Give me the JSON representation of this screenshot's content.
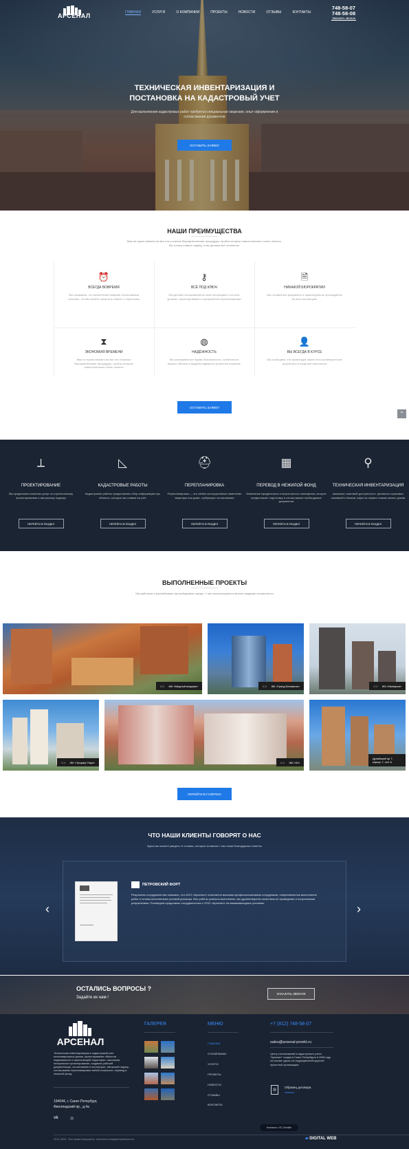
{
  "header": {
    "logo": "АРСЕНАЛ",
    "nav": [
      "ГЛАВНАЯ",
      "УСЛУГИ",
      "О КОМПАНИИ",
      "ПРОЕКТЫ",
      "НОВОСТИ",
      "ОТЗЫВЫ",
      "КОНТАКТЫ"
    ],
    "phone1": "748-58-07",
    "phone2": "748-58-08",
    "callback": "Заказать звонок"
  },
  "hero": {
    "title_line1": "ТЕХНИЧЕСКАЯ ИНВЕНТАРИЗАЦИЯ И",
    "title_line2": "ПОСТАНОВКА НА КАДАСТРОВЫЙ УЧЕТ",
    "subtitle": "Для выполнения кадастровых работ требуется специальная лицензия, опыт оформления и согласования документов",
    "button": "ОСТАВИТЬ ЗАЯВКУ"
  },
  "advantages": {
    "title": "НАШИ ПРЕИМУЩЕСТВА",
    "subtitle": "Вам не нужно вникать во все эти сложные бюрократические процедуры, пройти которые самостоятельно очень нелегко. Вы только ставите задачу, а мы делаем всё остальное.",
    "items": [
      {
        "title": "ВСЕГДА ВОВРЕМЯ",
        "text": "Мы понимаем, что выполнение вовремя согласования означает, что Вы можете запустить объект с открытыми"
      },
      {
        "title": "ВСЁ ПОД КЛЮЧ",
        "text": "Мы делаем согласования во всех инстанциях и на всех уровнях: проектирование и оформление перепланировки"
      },
      {
        "title": "НИКАКОЙ БЮРОКРАТИИ",
        "text": "Мы готовим все документы и гарантируем их прохождение во всех инстанциях"
      },
      {
        "title": "ЭКОНОМИЯ ВРЕМЕНИ",
        "text": "Вам не нужно вникать во все эти сложные бюрократические процедуры, пройти которые самостоятельно очень нелегко"
      },
      {
        "title": "НАДЁЖНОСТЬ",
        "text": "Мы учитываем все нормы безопасности, особенности вашего объекта и выдаём надёжное проектное решение"
      },
      {
        "title": "ВЫ ВСЕГДА В КУРСЕ",
        "text": "Мы сообщаем, что происходит, какие есть промежуточные результаты и когда всё закончится"
      }
    ],
    "button": "ОСТАВИТЬ ЗАЯВКУ"
  },
  "services": {
    "items": [
      {
        "title": "ПРОЕКТИРОВАНИЕ",
        "text": "Мы предлагаем комплекс услуг по строительному проектированию и авторскому надзору",
        "button": "ПЕРЕЙТИ В РАЗДЕЛ"
      },
      {
        "title": "КАДАСТРОВЫЕ РАБОТЫ",
        "text": "Кадастровые работы предполагают сбор информации про объекты, которые мы ставим на учёт",
        "button": "ПЕРЕЙТИ В РАЗДЕЛ"
      },
      {
        "title": "ПЕРЕПЛАНИРОВКА",
        "text": "Перепланировка — это любое конструктивное изменение квартиры или дома, требующее согласования",
        "button": "ПЕРЕЙТИ В РАЗДЕЛ"
      },
      {
        "title": "ПЕРЕВОД В НЕЖИЛОЙ ФОНД",
        "text": "Изменение юридического статуса жилого помещения, которое предполагает подготовку и согласование необходимых документов",
        "button": "ПЕРЕЙТИ В РАЗДЕЛ"
      },
      {
        "title": "ТЕХНИЧЕСКАЯ ИНВЕНТАРИЗАЦИЯ",
        "text": "магазины «шаговой доступности», филиалы страховых компаний и банков, кафе на первых этажах жилых домов",
        "button": "ПЕРЕЙТИ В РАЗДЕЛ"
      }
    ]
  },
  "projects": {
    "title": "ВЫПОЛНЕННЫЕ ПРОЕКТЫ",
    "subtitle": "Мы работаем с крупнейшими застройщиками города. У нас консультируются многие ведущие специалисты",
    "items": [
      {
        "label": "ЖК «Медный всадник»"
      },
      {
        "label": "ЖК «Гранд Бельвиль»"
      },
      {
        "label": "ЖК «Империя»"
      },
      {
        "label": "ЖК «Триумф Парк»"
      },
      {
        "label": "ЖК «Ю»"
      },
      {
        "label": "Дунайский пр 7, корпус 7, лит А"
      }
    ],
    "button": "ПЕРЕЙТИ В ГАЛЕРЕЮ"
  },
  "reviews": {
    "title": "ЧТО НАШИ КЛИЕНТЫ ГОВОРЯТ О НАС",
    "subtitle": "Здесь вы можете увидеть те отзывы, которые оставили о нас наши благодарные клиенты",
    "company": "ПЕТРОВСКИЙ ФОРТ",
    "text": "Результаты сотрудничества показали, что ООО «Арсенал» отличается высоким профессионализмом сотрудников, оперативностью выполнения работ и четким исполнением условий договора. Все работы успешно выполнены, мы удовлетворены качеством их проведения и полученными результатами. Планируем продолжать сотрудничество с ООО «Арсенал» на взаимовыгодных условиях."
  },
  "cta": {
    "title": "ОСТАЛИСЬ ВОПРОСЫ ?",
    "subtitle": "Задайте их нам !",
    "button": "ЗАКАЗАТЬ ЗВОНОК"
  },
  "footer": {
    "logo": "АРСЕНАЛ",
    "about": "Техническая инвентаризация и кадастровый учет многоквартирных домов, проектирование объектов недвижимости и прилегающей территории, изыскания, генеральное проектирование, создание рабочей документации, согласование в инстанциях, авторский надзор, согласование перепланировки любой сложности, перевод в нежилой фонд.",
    "address1": "194044, г. Санкт-Петербург,",
    "address2": "Финляндский пр., д.4а",
    "gallery_title": "ГАЛЕРЕЯ",
    "menu_title": "МЕНЮ",
    "menu": [
      "ГЛАВНАЯ",
      "О КОМПАНИИ",
      "УСЛУГИ",
      "ПРОЕКТЫ",
      "НОВОСТИ",
      "ОТЗЫВЫ",
      "КОНТАКТЫ"
    ],
    "phone": "+7 (812) 748-58-07",
    "email": "sales@arsenal-proekt.ru",
    "company_text": "Центр согласований и кадастрового учета \"Арсенал\" создан в Санкт-Петербурге в 2008 году на основе одного из подразделений крупной проектной организации.",
    "doc_title": "Образец договора",
    "doc_link": "скачать",
    "copyright": "2014-2016 · Все права защищены, политика конфиденциальности",
    "dev": "DIGITAL WEB",
    "chat": "Контакты • 9С Онлайн"
  }
}
